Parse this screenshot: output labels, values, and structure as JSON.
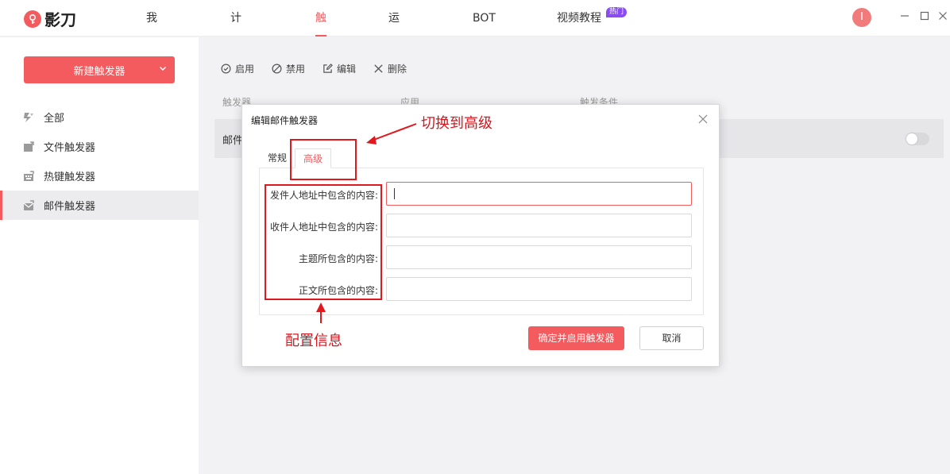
{
  "app": {
    "logo_text": "影刀"
  },
  "nav": {
    "items": [
      {
        "label": "我的应用"
      },
      {
        "label": "计划执行"
      },
      {
        "label": "触发器"
      },
      {
        "label": "运行日志"
      },
      {
        "label": "BOT市场"
      },
      {
        "label": "视频教程"
      }
    ],
    "active_index": 2,
    "hot_badge": "热门"
  },
  "user": {
    "avatar_initial": "I"
  },
  "sidebar": {
    "new_button_label": "新建触发器",
    "items": [
      {
        "label": "全部",
        "icon": "lightning-icon"
      },
      {
        "label": "文件触发器",
        "icon": "file-icon"
      },
      {
        "label": "热键触发器",
        "icon": "keyboard-icon"
      },
      {
        "label": "邮件触发器",
        "icon": "mail-icon"
      }
    ],
    "active_index": 3
  },
  "toolbar": {
    "enable": "启用",
    "disable": "禁用",
    "edit": "编辑",
    "delete": "删除"
  },
  "table": {
    "columns": [
      "触发器",
      "应用",
      "触发条件"
    ],
    "rows": [
      {
        "name": "邮件"
      }
    ]
  },
  "dialog": {
    "title": "编辑邮件触发器",
    "tabs": [
      {
        "label": "常规"
      },
      {
        "label": "高级"
      }
    ],
    "active_tab": 1,
    "fields": [
      {
        "label": "发件人地址中包含的内容:",
        "value": ""
      },
      {
        "label": "收件人地址中包含的内容:",
        "value": ""
      },
      {
        "label": "主题所包含的内容:",
        "value": ""
      },
      {
        "label": "正文所包含的内容:",
        "value": ""
      }
    ],
    "confirm_label": "确定并启用触发器",
    "cancel_label": "取消"
  },
  "annotations": {
    "switch_tab": "切换到高级",
    "config_info": "配置信息",
    "color": "#e0191f"
  },
  "colors": {
    "accent": "#f45b5f",
    "badge": "#8a4cf0"
  }
}
